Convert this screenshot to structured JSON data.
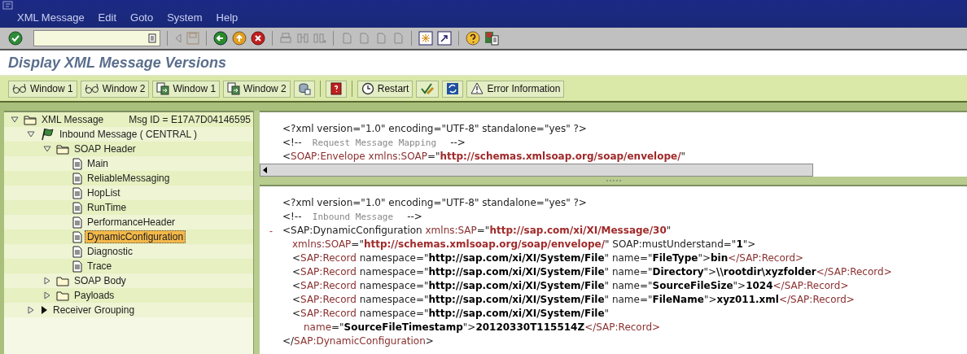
{
  "menu": [
    {
      "label": "XML Message"
    },
    {
      "label": "Edit"
    },
    {
      "label": "Goto"
    },
    {
      "label": "System"
    },
    {
      "label": "Help"
    }
  ],
  "title": "Display XML Message Versions",
  "app_toolbar": [
    {
      "kind": "glasses",
      "label": "Window 1"
    },
    {
      "kind": "glasses",
      "label": "Window 2"
    },
    {
      "kind": "copy",
      "label": "Window 1"
    },
    {
      "kind": "copy",
      "label": "Window 2"
    },
    {
      "kind": "db"
    },
    {
      "kind": "sep"
    },
    {
      "kind": "book"
    },
    {
      "kind": "sep"
    },
    {
      "kind": "clock",
      "label": "Restart"
    },
    {
      "kind": "check"
    },
    {
      "kind": "refresh"
    },
    {
      "kind": "warning",
      "label": "Error Information"
    }
  ],
  "tree": [
    {
      "label": "XML Message",
      "extra": "Msg ID =  E17A7D04146595",
      "kind": "folder",
      "expanded": true,
      "children": [
        {
          "label": "Inbound Message ( CENTRAL )",
          "kind": "flag",
          "expanded": true,
          "children": [
            {
              "label": "SOAP Header",
              "kind": "folder",
              "expanded": true,
              "children": [
                {
                  "label": "Main",
                  "kind": "document",
                  "selected": false
                },
                {
                  "label": "ReliableMessaging",
                  "kind": "document",
                  "selected": false
                },
                {
                  "label": "HopList",
                  "kind": "document",
                  "selected": false
                },
                {
                  "label": "RunTime",
                  "kind": "document",
                  "selected": false
                },
                {
                  "label": "PerformanceHeader",
                  "kind": "document",
                  "selected": false
                },
                {
                  "label": "DynamicConfiguration",
                  "kind": "document",
                  "selected": true
                },
                {
                  "label": "Diagnostic",
                  "kind": "document",
                  "selected": false
                },
                {
                  "label": "Trace",
                  "kind": "document",
                  "selected": false
                }
              ]
            },
            {
              "label": "SOAP Body",
              "kind": "folder",
              "expanded": false
            },
            {
              "label": "Payloads",
              "kind": "folder",
              "expanded": false
            }
          ]
        },
        {
          "label": "Receiver Grouping",
          "kind": "pointer",
          "expanded": false
        }
      ]
    }
  ],
  "upper_pane": {
    "lines": [
      [
        {
          "kind": "mark",
          "text": "<?xml version=\"1.0\" encoding=\"UTF-8\" standalone=\"yes\" ?>"
        }
      ],
      [
        {
          "kind": "mark",
          "text": "<!--"
        },
        {
          "kind": "comment",
          "text": "  Request Message Mapping  "
        },
        {
          "kind": "mark",
          "text": " -->"
        }
      ],
      [
        {
          "kind": "mark",
          "text": "<"
        },
        {
          "kind": "name",
          "text": "SOAP:Envelope xmlns:SOAP"
        },
        {
          "kind": "mark",
          "text": "=\""
        },
        {
          "kind": "url",
          "text": "http://schemas.xmlsoap.org/soap/envelope/"
        },
        {
          "kind": "mark",
          "text": "\""
        }
      ]
    ]
  },
  "lower_pane": {
    "prolog": [
      [
        {
          "kind": "mark",
          "text": "<?xml version=\"1.0\" encoding=\"UTF-8\" standalone=\"yes\" ?>"
        }
      ],
      [
        {
          "kind": "mark",
          "text": "<!--"
        },
        {
          "kind": "comment",
          "text": "  Inbound Message  "
        },
        {
          "kind": "mark",
          "text": " -->"
        }
      ]
    ],
    "element": {
      "toggle": "-",
      "open": [
        [
          {
            "kind": "mark",
            "text": "<SAP:DynamicConfiguration "
          },
          {
            "kind": "name",
            "text": "xmlns:SAP"
          },
          {
            "kind": "mark",
            "text": "=\""
          },
          {
            "kind": "url",
            "text": "http://sap.com/xi/XI/Message/30"
          },
          {
            "kind": "mark",
            "text": "\""
          }
        ],
        [
          {
            "kind": "name",
            "text": "xmlns:SOAP"
          },
          {
            "kind": "mark",
            "text": "=\""
          },
          {
            "kind": "url",
            "text": "http://schemas.xmlsoap.org/soap/envelope/"
          },
          {
            "kind": "mark",
            "text": "\" SOAP:mustUnderstand=\""
          },
          {
            "kind": "value",
            "text": "1"
          },
          {
            "kind": "mark",
            "text": "\">"
          }
        ]
      ],
      "children": [
        {
          "lines": [
            [
              {
                "kind": "mark",
                "text": "<"
              },
              {
                "kind": "name",
                "text": "SAP:Record"
              },
              {
                "kind": "mark",
                "text": " namespace=\""
              },
              {
                "kind": "value",
                "text": "http://sap.com/xi/XI/System/File"
              },
              {
                "kind": "mark",
                "text": "\" name=\""
              },
              {
                "kind": "value",
                "text": "FileType"
              },
              {
                "kind": "mark",
                "text": "\">"
              },
              {
                "kind": "value",
                "text": "bin"
              },
              {
                "kind": "name",
                "text": "</SAP:Record>"
              }
            ]
          ]
        },
        {
          "lines": [
            [
              {
                "kind": "mark",
                "text": "<"
              },
              {
                "kind": "name",
                "text": "SAP:Record"
              },
              {
                "kind": "mark",
                "text": " namespace=\""
              },
              {
                "kind": "value",
                "text": "http://sap.com/xi/XI/System/File"
              },
              {
                "kind": "mark",
                "text": "\" name=\""
              },
              {
                "kind": "value",
                "text": "Directory"
              },
              {
                "kind": "mark",
                "text": "\">"
              },
              {
                "kind": "value",
                "text": "\\\\rootdir\\xyzfolder"
              },
              {
                "kind": "name",
                "text": "</SAP:Record>"
              }
            ]
          ]
        },
        {
          "lines": [
            [
              {
                "kind": "mark",
                "text": "<"
              },
              {
                "kind": "name",
                "text": "SAP:Record"
              },
              {
                "kind": "mark",
                "text": " namespace=\""
              },
              {
                "kind": "value",
                "text": "http://sap.com/xi/XI/System/File"
              },
              {
                "kind": "mark",
                "text": "\" name=\""
              },
              {
                "kind": "value",
                "text": "SourceFileSize"
              },
              {
                "kind": "mark",
                "text": "\">"
              },
              {
                "kind": "value",
                "text": "1024"
              },
              {
                "kind": "name",
                "text": "</SAP:Record>"
              }
            ]
          ]
        },
        {
          "lines": [
            [
              {
                "kind": "mark",
                "text": "<"
              },
              {
                "kind": "name",
                "text": "SAP:Record"
              },
              {
                "kind": "mark",
                "text": " namespace=\""
              },
              {
                "kind": "value",
                "text": "http://sap.com/xi/XI/System/File"
              },
              {
                "kind": "mark",
                "text": "\" name=\""
              },
              {
                "kind": "value",
                "text": "FileName"
              },
              {
                "kind": "mark",
                "text": "\">"
              },
              {
                "kind": "value",
                "text": "xyz011.xml"
              },
              {
                "kind": "name",
                "text": "</SAP:Record>"
              }
            ]
          ]
        },
        {
          "lines": [
            [
              {
                "kind": "mark",
                "text": "<"
              },
              {
                "kind": "name",
                "text": "SAP:Record"
              },
              {
                "kind": "mark",
                "text": " namespace=\""
              },
              {
                "kind": "value",
                "text": "http://sap.com/xi/XI/System/File"
              },
              {
                "kind": "mark",
                "text": "\""
              }
            ],
            [
              {
                "kind": "name",
                "text": "name"
              },
              {
                "kind": "mark",
                "text": "=\""
              },
              {
                "kind": "value",
                "text": "SourceFileTimestamp"
              },
              {
                "kind": "mark",
                "text": "\">"
              },
              {
                "kind": "value",
                "text": "20120330T115514Z"
              },
              {
                "kind": "name",
                "text": "</SAP:Record>"
              }
            ]
          ]
        }
      ],
      "close": [
        {
          "kind": "mark",
          "text": "</"
        },
        {
          "kind": "name",
          "text": "SAP:DynamicConfiguration"
        },
        {
          "kind": "mark",
          "text": ">"
        }
      ]
    }
  }
}
